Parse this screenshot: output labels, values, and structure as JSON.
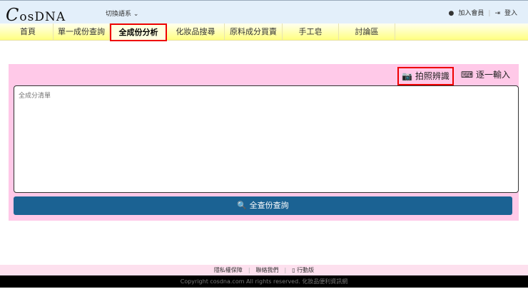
{
  "header": {
    "logo": "CosDNA",
    "lang": "切換語系",
    "join": "加入會員",
    "login": "登入"
  },
  "nav": [
    "首頁",
    "單一成份查詢",
    "全成份分析",
    "化妝品搜尋",
    "原料成分買賣",
    "手工皂",
    "討論區"
  ],
  "panel": {
    "photo": "拍照辨識",
    "manual": "逐一輸入",
    "placeholder": "全成分清單",
    "search": "全查份查詢"
  },
  "footer": {
    "privacy": "隱私權保障",
    "contact": "聯絡我們",
    "mobile": "行動版",
    "copyright": "Copyright cosdna.com All rights reserved. 化妝品便利資訊網"
  }
}
